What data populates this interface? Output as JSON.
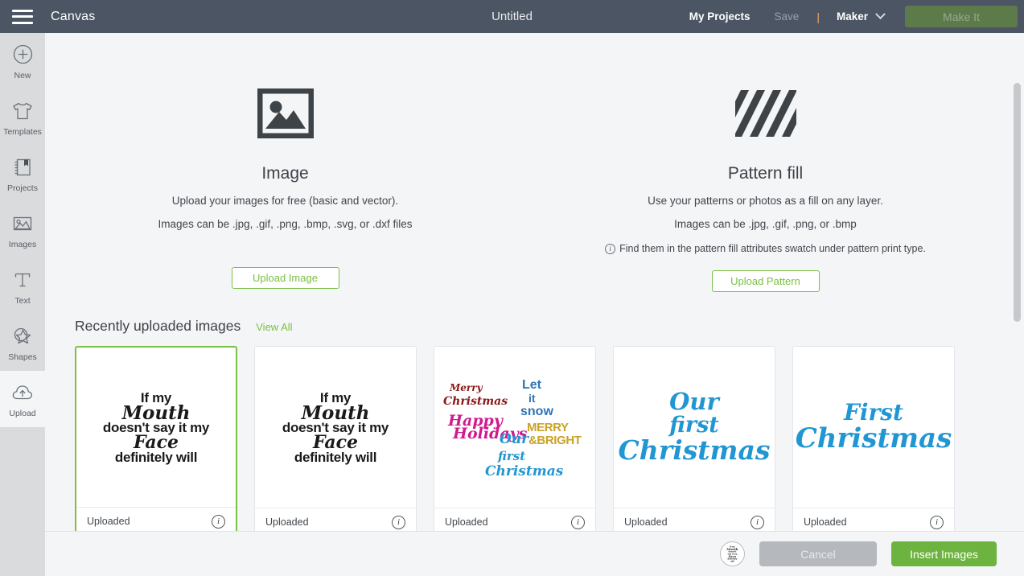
{
  "topbar": {
    "menu_icon": "hamburger-icon",
    "canvas_label": "Canvas",
    "project_title": "Untitled",
    "my_projects_label": "My Projects",
    "save_label": "Save",
    "divider": "|",
    "machine_label": "Maker",
    "make_it_label": "Make It",
    "accent_orange": "#f0a868",
    "bar_bg": "#4b5563"
  },
  "sidebar": {
    "items": [
      {
        "label": "New",
        "icon": "plus-circle-icon",
        "active": false
      },
      {
        "label": "Templates",
        "icon": "tshirt-icon",
        "active": false
      },
      {
        "label": "Projects",
        "icon": "book-bookmark-icon",
        "active": false
      },
      {
        "label": "Images",
        "icon": "photo-icon",
        "active": false
      },
      {
        "label": "Text",
        "icon": "text-t-icon",
        "active": false
      },
      {
        "label": "Shapes",
        "icon": "star-shape-icon",
        "active": false
      },
      {
        "label": "Upload",
        "icon": "cloud-upload-icon",
        "active": true
      }
    ]
  },
  "upload": {
    "image": {
      "icon": "picture-frame-icon",
      "title": "Image",
      "line1": "Upload your images for free (basic and vector).",
      "line2": "Images can be .jpg, .gif, .png, .bmp, .svg, or .dxf files",
      "button_label": "Upload Image"
    },
    "pattern": {
      "icon": "diagonal-stripes-icon",
      "title": "Pattern fill",
      "line1": "Use your patterns or photos as a fill on any layer.",
      "line2": "Images can be .jpg, .gif, .png, or .bmp",
      "note": "Find them in the pattern fill attributes swatch under pattern print type.",
      "note_icon": "info-icon",
      "button_label": "Upload Pattern"
    },
    "button_accent": "#7ac143"
  },
  "recent": {
    "title": "Recently uploaded images",
    "view_all_label": "View All",
    "cards": [
      {
        "status": "Uploaded",
        "info_icon": "info-icon",
        "selected": true,
        "art": "mouth-face-quote",
        "art_lines": [
          "If my",
          "Mouth",
          "doesn't say it my",
          "Face",
          "definitely will"
        ]
      },
      {
        "status": "Uploaded",
        "info_icon": "info-icon",
        "selected": false,
        "art": "mouth-face-quote",
        "art_lines": [
          "If my",
          "Mouth",
          "doesn't say it my",
          "Face",
          "definitely will"
        ]
      },
      {
        "status": "Uploaded",
        "info_icon": "info-icon",
        "selected": false,
        "art": "christmas-collage",
        "collage": {
          "merry": "Merry",
          "christmas": "Christmas",
          "happy": "Happy",
          "holidays": "Holidays",
          "let": "Let",
          "it": "it",
          "snow": "snow",
          "merry_amp": "MERRY",
          "bright": "&BRIGHT",
          "our": "Our",
          "first": "first",
          "christmas2": "Christmas",
          "colors": {
            "merry_christmas": "#8c1616",
            "happy_holidays": "#cf1a8e",
            "let_it_snow": "#2f74b5",
            "merry_bright": "#c9a227",
            "our_first_christmas": "#2196d3"
          }
        }
      },
      {
        "status": "Uploaded",
        "info_icon": "info-icon",
        "selected": false,
        "art": "our-first-christmas",
        "art_lines": [
          "Our",
          "first",
          "Christmas"
        ],
        "color": "#2196d3"
      },
      {
        "status": "Uploaded",
        "info_icon": "info-icon",
        "selected": false,
        "art": "first-christmas",
        "art_lines": [
          "First",
          "Christmas"
        ],
        "color": "#2196d3"
      }
    ]
  },
  "scrollbar": {
    "name": "vertical-scrollbar",
    "thumb_name": "scrollbar-thumb"
  },
  "bottombar": {
    "selected_thumb_name": "selected-image-thumbnail",
    "cancel_label": "Cancel",
    "insert_label": "Insert Images",
    "insert_color": "#6db33f",
    "cancel_color": "#b5b8bc"
  }
}
